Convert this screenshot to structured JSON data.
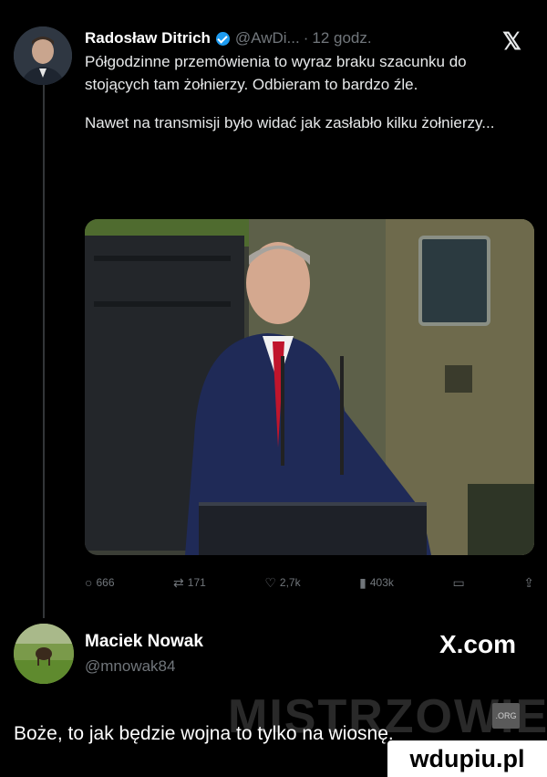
{
  "tweet": {
    "author": "Radosław Ditrich",
    "handle": "@AwDi...",
    "separator": "·",
    "time": "12 godz.",
    "text_1": "Półgodzinne przemówienia to wyraz braku szacunku do stojących tam żołnierzy. Odbieram to bardzo źle.",
    "text_2": "Nawet na transmisji było widać jak zasłabło kilku żołnierzy...",
    "stats": {
      "replies": "666",
      "reposts": "171",
      "likes": "2,7k",
      "views": "403k"
    }
  },
  "reply": {
    "author": "Maciek Nowak",
    "handle": "@mnowak84",
    "source": "X.com",
    "text": "Boże, to jak będzie wojna to tylko na wiosnę."
  },
  "watermark": {
    "text": "MISTRZOWIE",
    "badge": ".ORG"
  },
  "footer": {
    "site": "wdupiu.pl"
  },
  "icons": {
    "close": "x-logo-icon",
    "reply": "comment-icon",
    "repost": "repost-icon",
    "like": "heart-icon",
    "views": "chart-icon",
    "bookmark": "bookmark-icon",
    "share": "share-icon"
  },
  "colors": {
    "background": "#000000",
    "text": "#e7e9ea",
    "muted": "#71767b",
    "verified": "#1d9bf0"
  }
}
